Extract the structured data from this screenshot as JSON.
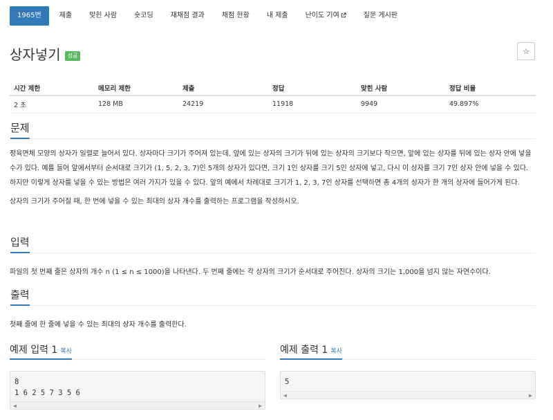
{
  "nav": {
    "tabs": [
      {
        "label": "1965번"
      },
      {
        "label": "제출"
      },
      {
        "label": "맞힌 사람"
      },
      {
        "label": "숏코딩"
      },
      {
        "label": "재채점 결과"
      },
      {
        "label": "채점 현황"
      },
      {
        "label": "내 제출"
      },
      {
        "label": "난이도 기여"
      },
      {
        "label": "질문 게시판"
      }
    ]
  },
  "problem": {
    "title": "상자넣기",
    "result_label": "성공",
    "star_icon": "☆"
  },
  "info_table": {
    "headers": [
      "시간 제한",
      "메모리 제한",
      "제출",
      "정답",
      "맞힌 사람",
      "정답 비율"
    ],
    "values": [
      "2 초",
      "128 MB",
      "24219",
      "11918",
      "9949",
      "49.897%"
    ]
  },
  "sections": {
    "description": {
      "title": "문제",
      "paragraphs": [
        "정육면체 모양의 상자가 일렬로 늘어서 있다. 상자마다 크기가 주어져 있는데, 앞에 있는 상자의 크기가 뒤에 있는 상자의 크기보다 작으면, 앞에 있는 상자를 뒤에 있는 상자 안에 넣을 수가 있다. 예를 들어 앞에서부터 순서대로 크기가 (1, 5, 2, 3, 7)인 5개의 상자가 있다면, 크기 1인 상자를 크기 5인 상자에 넣고, 다시 이 상자를 크기 7인 상자 안에 넣을 수 있다. 하지만 이렇게 상자를 넣을 수 있는 방법은 여러 가지가 있을 수 있다. 앞의 예에서 차례대로 크기가 1, 2, 3, 7인 상자를 선택하면 총 4개의 상자가 한 개의 상자에 들어가게 된다.",
        "상자의 크기가 주어질 때, 한 번에 넣을 수 있는 최대의 상자 개수를 출력하는 프로그램을 작성하시오."
      ]
    },
    "input": {
      "title": "입력",
      "text": "파일의 첫 번째 줄은 상자의 개수 n (1 ≤ n ≤ 1000)을 나타낸다. 두 번째 줄에는 각 상자의 크기가 순서대로 주어진다. 상자의 크기는 1,000을 넘지 않는 자연수이다."
    },
    "output": {
      "title": "출력",
      "text": "첫째 줄에 한 줄에 넣을 수 있는 최대의 상자 개수를 출력한다."
    }
  },
  "samples": {
    "input": {
      "title": "예제 입력 1",
      "copy_label": "복사",
      "code": "8\n1 6 2 5 7 3 5 6"
    },
    "output": {
      "title": "예제 출력 1",
      "copy_label": "복사",
      "code": "5"
    }
  },
  "colors": {
    "accent": "#3279b7",
    "success": "#5cb85c"
  }
}
